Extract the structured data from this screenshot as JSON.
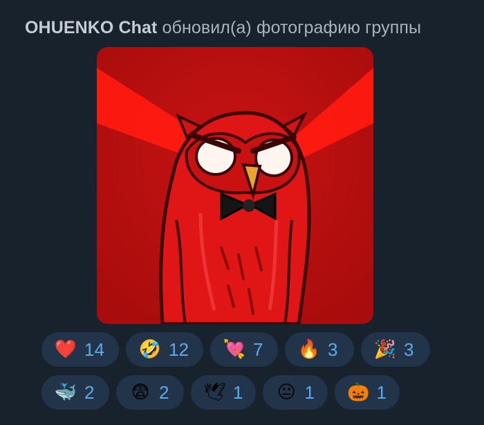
{
  "service_message": {
    "author": "OHUENKO Chat",
    "action": "обновил(а) фотографию группы"
  },
  "photo": {
    "subject": "red-owl-laser-eyes-bow-tie",
    "background_color": "#b60f0f",
    "owl_color": "#e01616",
    "beam_color": "#ff1a10"
  },
  "reactions": {
    "row1": [
      {
        "emoji": "❤️",
        "icon": "red-heart",
        "count": "14"
      },
      {
        "emoji": "🤣",
        "icon": "rolling-laughing-face",
        "count": "12"
      },
      {
        "emoji": "💘",
        "icon": "heart-with-arrow",
        "count": "7"
      },
      {
        "emoji": "🔥",
        "icon": "fire",
        "count": "3"
      },
      {
        "emoji": "🎉",
        "icon": "party-popper",
        "count": "3"
      }
    ],
    "row2": [
      {
        "emoji": "🐳",
        "icon": "whale",
        "count": "2"
      },
      {
        "emoji": "😨",
        "icon": "fearful-face",
        "count": "2"
      },
      {
        "emoji": "🕊",
        "icon": "dove",
        "count": "1"
      },
      {
        "emoji": "😐",
        "icon": "neutral-face",
        "count": "1"
      },
      {
        "emoji": "🎃",
        "icon": "jack-o-lantern",
        "count": "1"
      }
    ]
  },
  "colors": {
    "background": "#18222d",
    "pill_background": "#22344a",
    "count_text": "#5fa9ea",
    "service_text": "#aab3bd"
  }
}
